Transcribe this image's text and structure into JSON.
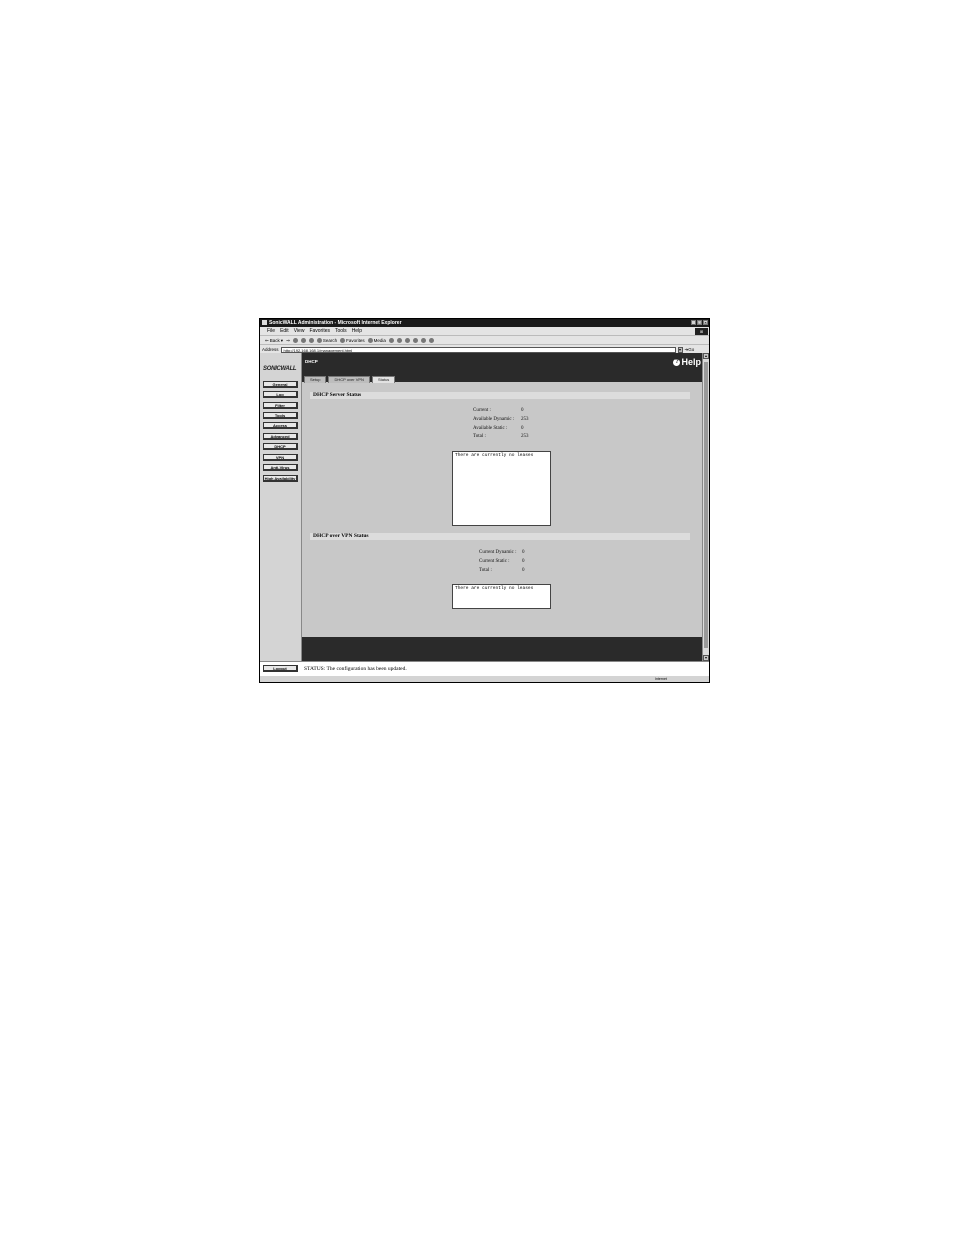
{
  "window": {
    "title": "SonicWALL Administration - Microsoft Internet Explorer"
  },
  "menu": [
    "File",
    "Edit",
    "View",
    "Favorites",
    "Tools",
    "Help"
  ],
  "toolbar": {
    "back": "Back",
    "search": "Search",
    "favorites": "Favorites",
    "media": "Media"
  },
  "address": {
    "label": "Address",
    "url": "http://192.168.168.1/management.html",
    "go": "Go"
  },
  "nav": {
    "logo": "SONICWALL",
    "items": [
      "General",
      "Log",
      "Filter",
      "Tools",
      "Access",
      "Advanced",
      "DHCP",
      "VPN",
      "Anti-Virus",
      "High Availability"
    ],
    "logout": "Logout"
  },
  "page": {
    "title": "DHCP",
    "help": "Help",
    "tabs": [
      "Setup",
      "DHCP over VPN",
      "Status"
    ],
    "active_tab": "Status"
  },
  "dhcp_server": {
    "heading": "DHCP Server Status",
    "rows": [
      {
        "label": "Current :",
        "value": "0"
      },
      {
        "label": "Available Dynamic :",
        "value": "253"
      },
      {
        "label": "Available Static :",
        "value": "0"
      },
      {
        "label": "Total :",
        "value": "253"
      }
    ],
    "leases_text": "There are currently no leases"
  },
  "dhcp_vpn": {
    "heading": "DHCP over VPN Status",
    "rows": [
      {
        "label": "Current Dynamic :",
        "value": "0"
      },
      {
        "label": "Current Static :",
        "value": "0"
      },
      {
        "label": "Total :",
        "value": "0"
      }
    ],
    "leases_text": "There are currently no leases"
  },
  "status": {
    "message": "STATUS: The configuration has been updated."
  },
  "statusbar": {
    "zone": "Internet"
  }
}
